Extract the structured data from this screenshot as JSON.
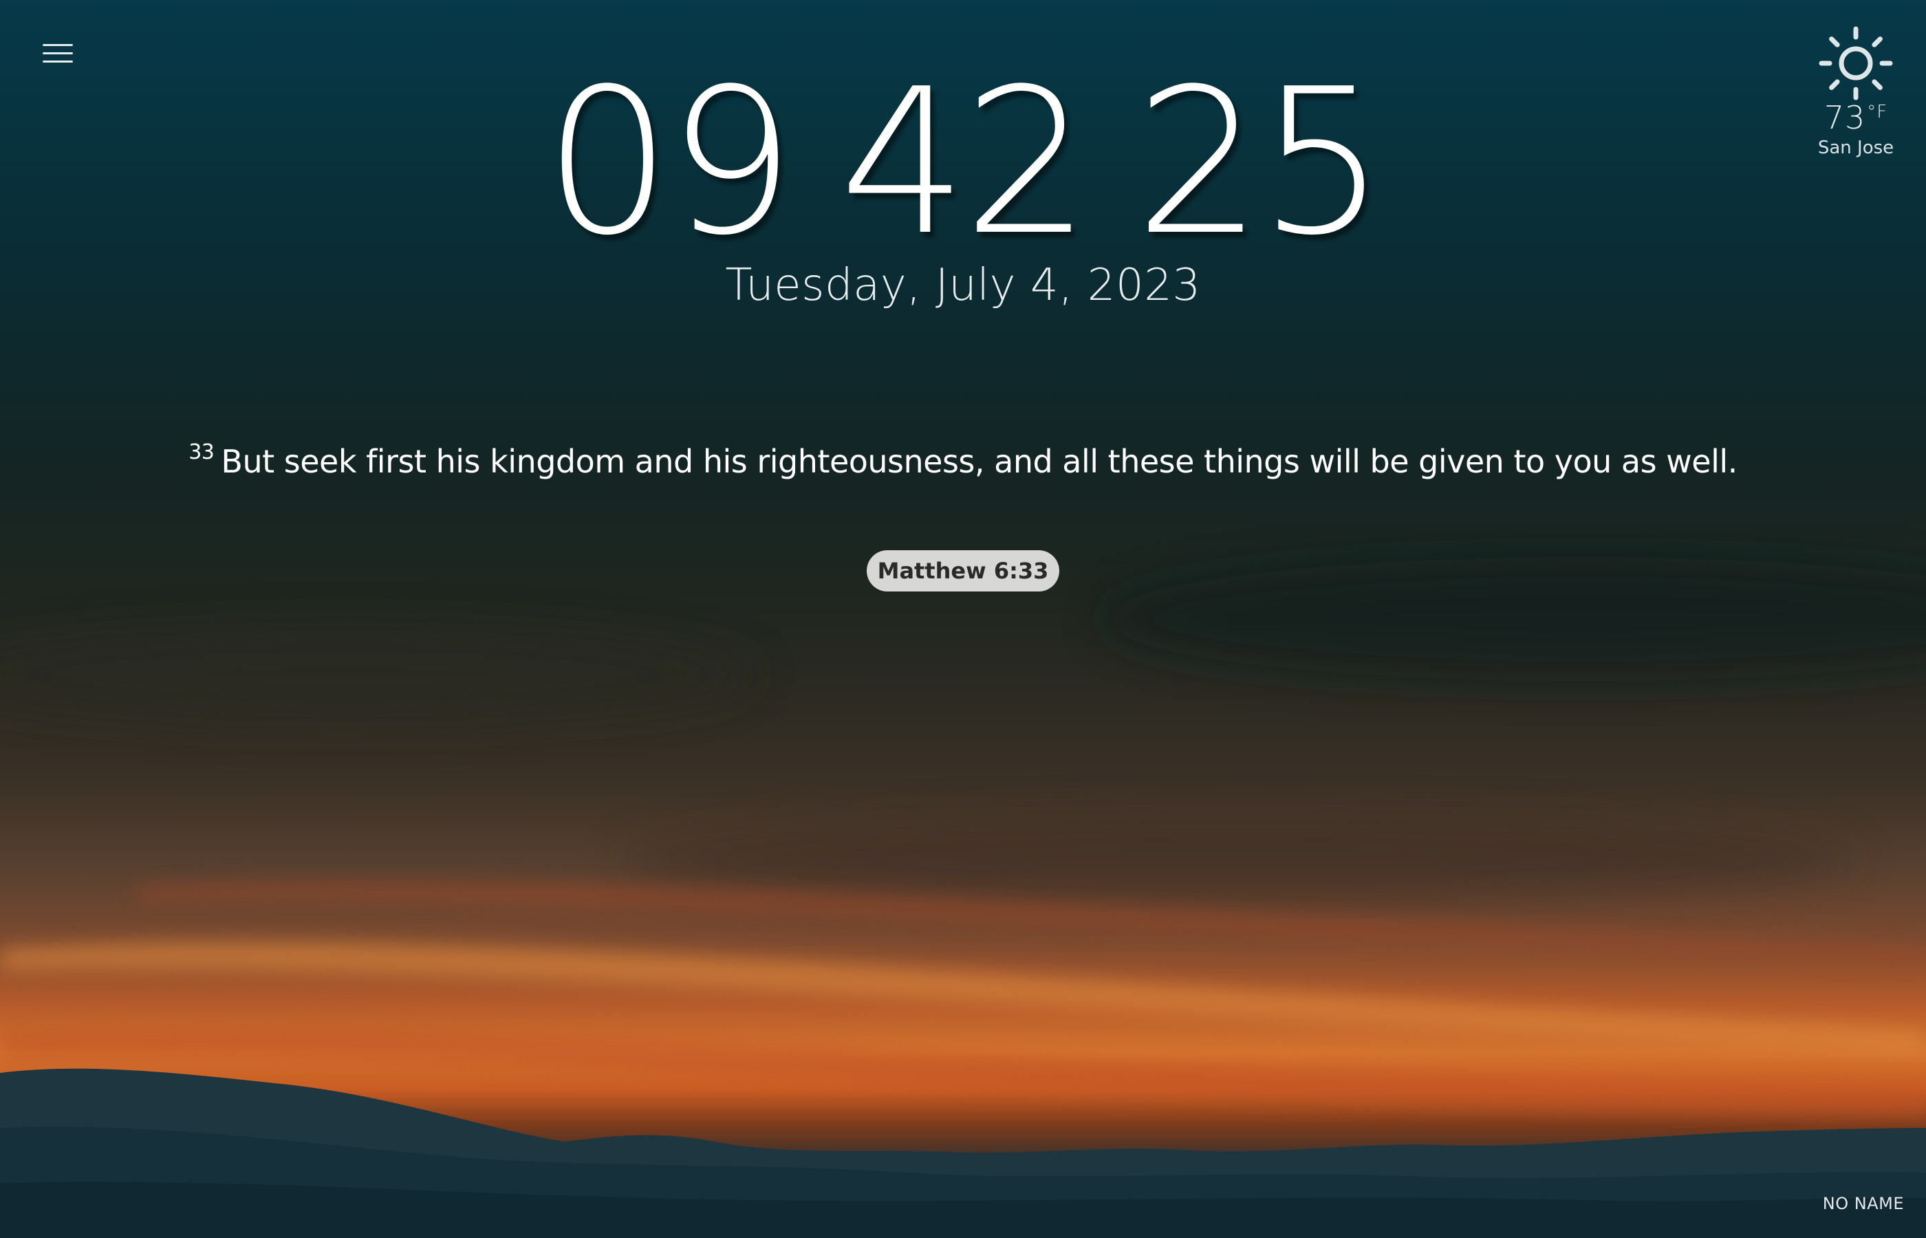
{
  "header": {
    "menu_icon": "hamburger-menu-icon"
  },
  "weather": {
    "icon": "sun-icon",
    "temperature": "73",
    "unit": "°F",
    "city": "San Jose"
  },
  "clock": {
    "hours": "09",
    "minutes": "42",
    "seconds": "25",
    "date": "Tuesday, July 4, 2023"
  },
  "verse": {
    "number": "33",
    "text": "But seek first his kingdom and his righteousness, and all these things will be given to you as well.",
    "reference": "Matthew 6:33"
  },
  "footer": {
    "name": "NO NAME"
  },
  "colors": {
    "sky_top": "#06394a",
    "sunset_orange": "#d4732f",
    "reference_pill": "#d7d7d5"
  }
}
